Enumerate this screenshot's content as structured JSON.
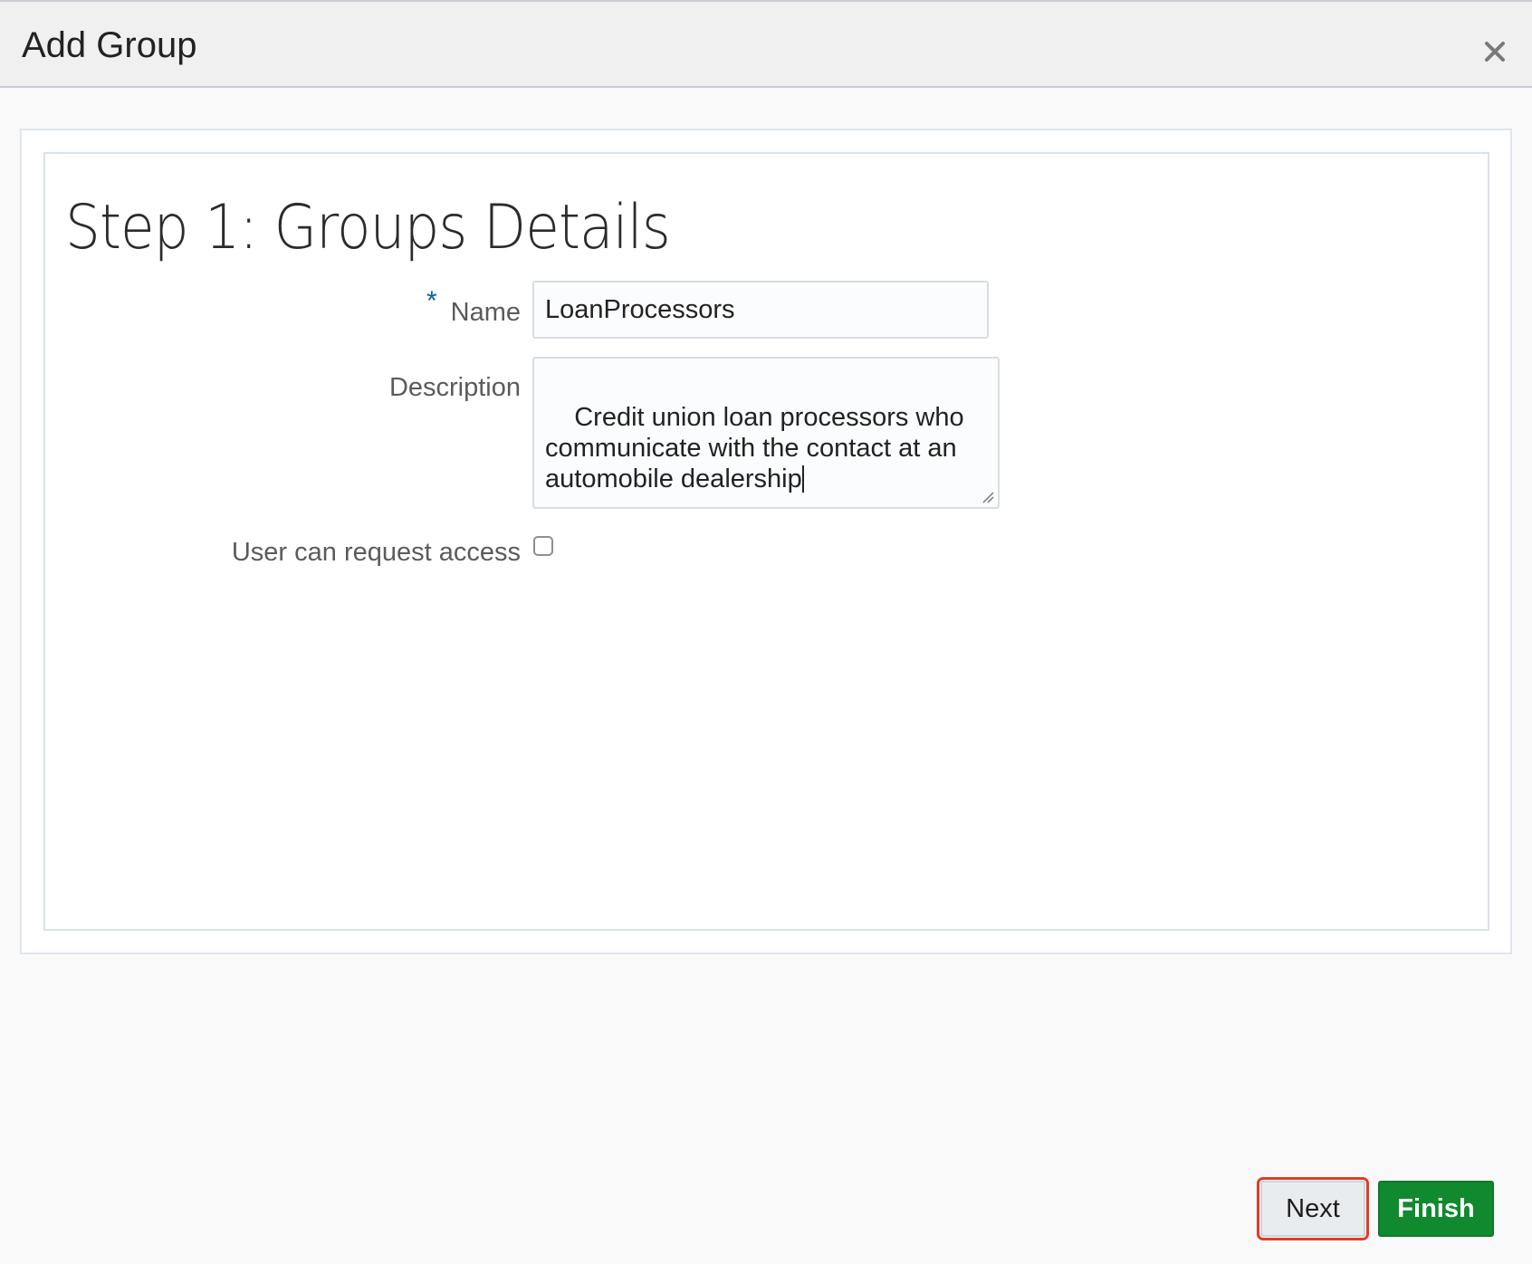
{
  "dialog": {
    "title": "Add Group",
    "close_icon": "close-icon"
  },
  "step": {
    "heading": "Step 1: Groups Details"
  },
  "form": {
    "required_marker": "*",
    "name_label": "Name",
    "name_value": "LoanProcessors",
    "description_label": "Description",
    "description_value": "Credit union loan processors who\ncommunicate with the contact at an\nautomobile dealership",
    "access_label": "User can request access",
    "access_checked": false
  },
  "buttons": {
    "next_label": "Next",
    "finish_label": "Finish"
  },
  "colors": {
    "finish_bg": "#11892f",
    "highlight_outline": "#e23b2a",
    "required_star": "#0a5fa8"
  }
}
